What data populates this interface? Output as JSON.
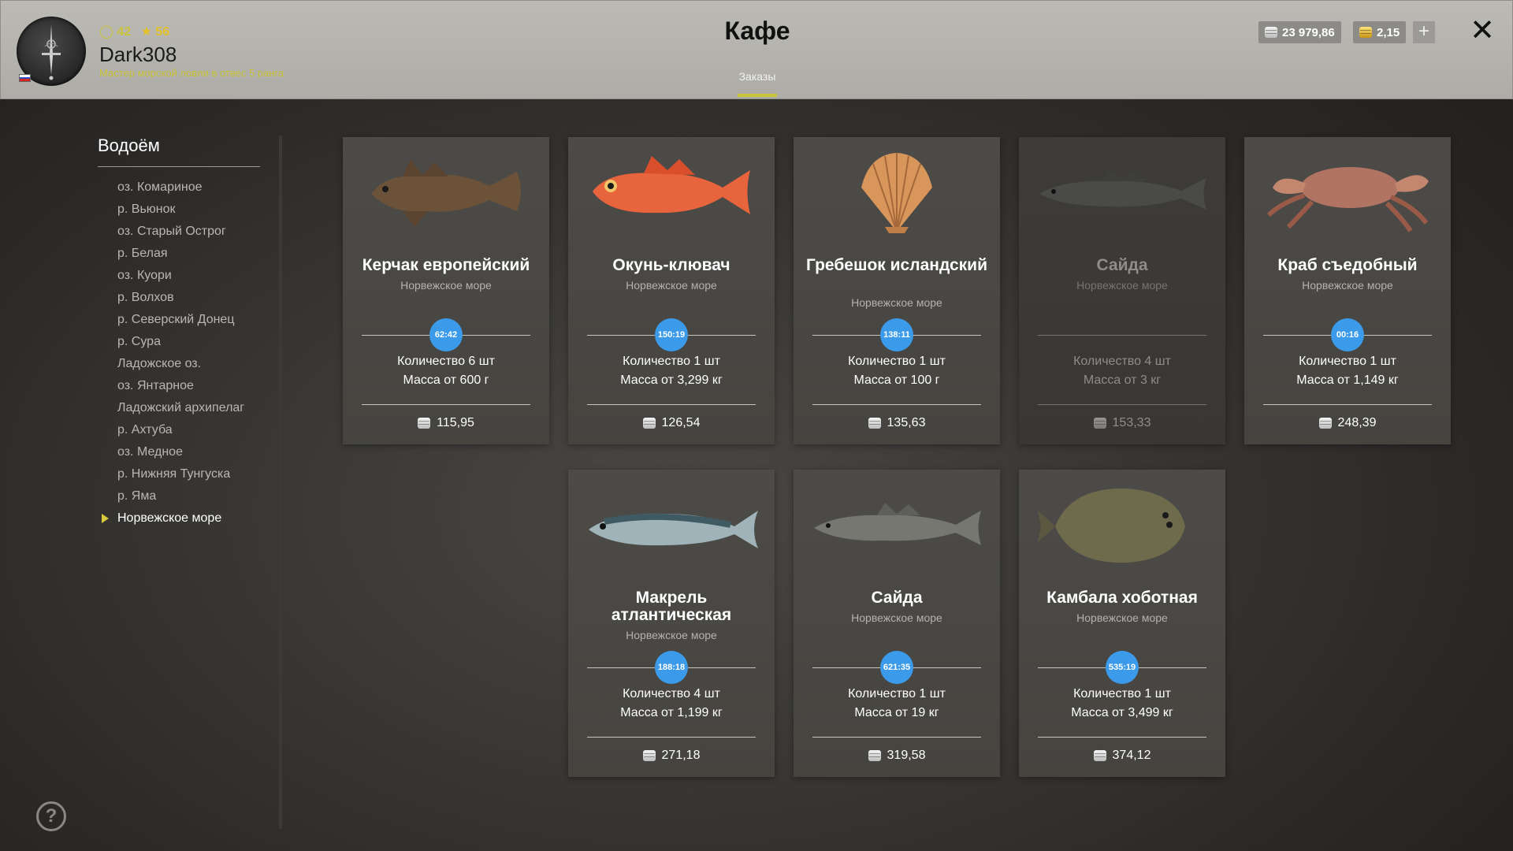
{
  "header": {
    "title": "Кафе",
    "tab": "Заказы",
    "player": {
      "level": "42",
      "stars": "56",
      "name": "Dark308",
      "rank": "Мастер морской ловли в отвес 5 ранга"
    },
    "currency": {
      "silver": "23 979,86",
      "gold": "2,15"
    }
  },
  "sidebar": {
    "title": "Водоём",
    "items": [
      {
        "label": "оз. Комариное"
      },
      {
        "label": "р. Вьюнок"
      },
      {
        "label": "оз. Старый Острог"
      },
      {
        "label": "р. Белая"
      },
      {
        "label": "оз. Куори"
      },
      {
        "label": "р. Волхов"
      },
      {
        "label": "р. Северский Донец"
      },
      {
        "label": "р. Сура"
      },
      {
        "label": "Ладожское оз."
      },
      {
        "label": "оз. Янтарное"
      },
      {
        "label": "Ладожский архипелаг"
      },
      {
        "label": "р. Ахтуба"
      },
      {
        "label": "оз. Медное"
      },
      {
        "label": "р. Нижняя Тунгуска"
      },
      {
        "label": "р. Яма"
      },
      {
        "label": "Норвежское море",
        "active": true
      }
    ]
  },
  "orders": [
    {
      "name": "Керчак европейский",
      "location": "Норвежское море",
      "timer": "62:42",
      "qty": "Количество 6 шт",
      "mass": "Масса от 600 г",
      "price": "115,95",
      "icon": "sculpin-fish-icon"
    },
    {
      "name": "Окунь-клювач",
      "location": "Норвежское море",
      "timer": "150:19",
      "qty": "Количество 1 шт",
      "mass": "Масса от 3,299 кг",
      "price": "126,54",
      "icon": "redfish-icon"
    },
    {
      "name": "Гребешок исландский",
      "location": "Норвежское море",
      "timer": "138:11",
      "qty": "Количество 1 шт",
      "mass": "Масса от 100 г",
      "price": "135,63",
      "icon": "scallop-icon"
    },
    {
      "name": "Сайда",
      "location": "Норвежское море",
      "timer": "",
      "qty": "Количество 4 шт",
      "mass": "Масса от 3 кг",
      "price": "153,33",
      "icon": "saithe-fish-icon",
      "dim": true
    },
    {
      "name": "Краб съедобный",
      "location": "Норвежское море",
      "timer": "00:16",
      "qty": "Количество 1 шт",
      "mass": "Масса от 1,149 кг",
      "price": "248,39",
      "icon": "crab-icon"
    },
    {
      "name": "Макрель атлантическая",
      "location": "Норвежское море",
      "timer": "188:18",
      "qty": "Количество 4 шт",
      "mass": "Масса от 1,199 кг",
      "price": "271,18",
      "icon": "mackerel-icon"
    },
    {
      "name": "Сайда",
      "location": "Норвежское море",
      "timer": "621:35",
      "qty": "Количество 1 шт",
      "mass": "Масса от 19 кг",
      "price": "319,58",
      "icon": "saithe-fish-icon"
    },
    {
      "name": "Камбала хоботная",
      "location": "Норвежское море",
      "timer": "535:19",
      "qty": "Количество 1 шт",
      "mass": "Масса от 3,499 кг",
      "price": "374,12",
      "icon": "flounder-icon"
    }
  ]
}
